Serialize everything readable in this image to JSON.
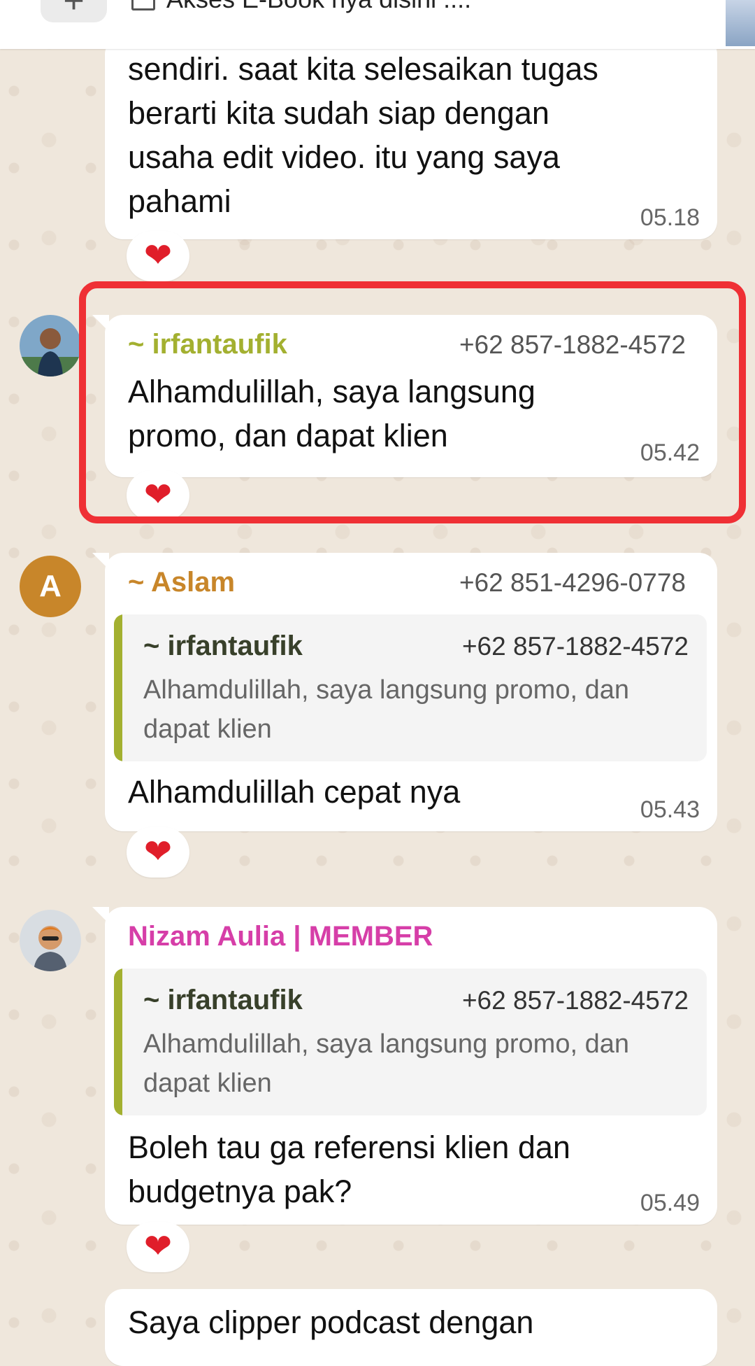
{
  "top_bar": {
    "plus_label": "+",
    "pinned_text": "Akses E-Book nya disini ...."
  },
  "messages": [
    {
      "text": "sendiri. saat kita selesaikan tugas berarti kita sudah siap dengan usaha edit video. itu yang saya pahami",
      "time": "05.18",
      "reaction": "❤"
    },
    {
      "sender": "~ irfantaufik",
      "phone": "+62 857-1882-4572",
      "text": "Alhamdulillah, saya langsung promo, dan dapat klien",
      "time": "05.42",
      "reaction": "❤",
      "highlighted": true
    },
    {
      "avatar_letter": "A",
      "sender": "~ Aslam",
      "phone": "+62 851-4296-0778",
      "quote": {
        "sender": "~ irfantaufik",
        "phone": "+62 857-1882-4572",
        "text": "Alhamdulillah, saya langsung promo, dan dapat klien"
      },
      "text": "Alhamdulillah cepat nya",
      "time": "05.43",
      "reaction": "❤"
    },
    {
      "sender": "Nizam Aulia | MEMBER",
      "quote": {
        "sender": "~ irfantaufik",
        "phone": "+62 857-1882-4572",
        "text": "Alhamdulillah, saya langsung promo, dan dapat klien"
      },
      "text": "Boleh tau ga referensi klien dan budgetnya pak?",
      "time": "05.49",
      "reaction": "❤"
    },
    {
      "text": "Saya clipper podcast dengan"
    }
  ],
  "colors": {
    "irfantaufik": "#a3b030",
    "aslam": "#c8862a",
    "nizam": "#d63ea8",
    "highlight": "#ef3035",
    "heart": "#e01e2a",
    "wallpaper": "#efe7dc"
  }
}
